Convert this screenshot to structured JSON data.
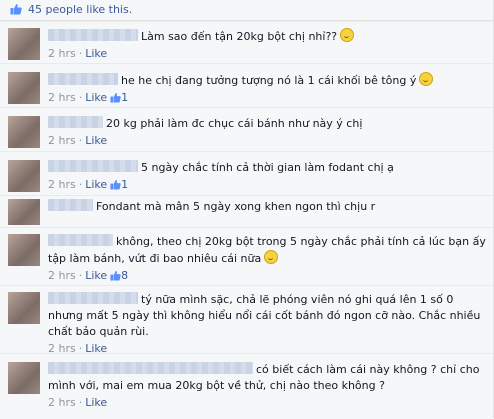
{
  "likes_bar": {
    "text": "45 people like this.",
    "like_icon": "thumbs-up-icon"
  },
  "comments": [
    {
      "name_mask_width": 90,
      "text": "Làm sao đến tận 20kg bột chị nhỉ??",
      "emoji": "smile-emoji-icon",
      "time": "2 hrs",
      "like_label": "Like",
      "like_count": ""
    },
    {
      "name_mask_width": 70,
      "text": "he he chị đang tưởng tượng nó là 1 cái khối bê tông ý",
      "emoji": "grin-emoji-icon",
      "time": "2 hrs",
      "like_label": "Like",
      "like_count": "1"
    },
    {
      "name_mask_width": 55,
      "text": "20 kg phải làm đc chục cái bánh như này ý chị",
      "emoji": "",
      "time": "2 hrs",
      "like_label": "Like",
      "like_count": ""
    },
    {
      "name_mask_width": 90,
      "text": "5 ngày chắc tính cả thời gian làm fodant chị ạ",
      "emoji": "",
      "time": "2 hrs",
      "like_label": "Like",
      "like_count": "1"
    },
    {
      "name_mask_width": 45,
      "text": "Fondant mà mân 5 ngày xong khen ngon thì chịu r",
      "emoji": "",
      "time": "2 hrs",
      "like_label": "Like",
      "like_count": ""
    },
    {
      "name_mask_width": 65,
      "text": "không, theo chị 20kg bột trong 5 ngày chắc phải tính cả lúc bạn ấy tập làm bánh, vứt đi bao nhiêu cái nữa",
      "emoji": "grin-emoji-icon",
      "time": "2 hrs",
      "like_label": "Like",
      "like_count": "8"
    },
    {
      "name_mask_width": 90,
      "text": "tý nữa mình sặc, chả lẽ phóng viên nó ghi quá lên 1 số 0 nhưng mất 5 ngày thì không hiểu nổi cái cốt bánh đó ngon cỡ nào. Chắc nhiều chất bảo quản rùi.",
      "emoji": "",
      "time": "2 hrs",
      "like_label": "Like",
      "like_count": ""
    },
    {
      "name_mask_width": 205,
      "text": "có biết cách làm cái này không ? chỉ cho mình với, mai em mua 20kg bột về thử, chị nào theo không ?",
      "emoji": "",
      "time": "2 hrs",
      "like_label": "Like",
      "like_count": ""
    }
  ]
}
